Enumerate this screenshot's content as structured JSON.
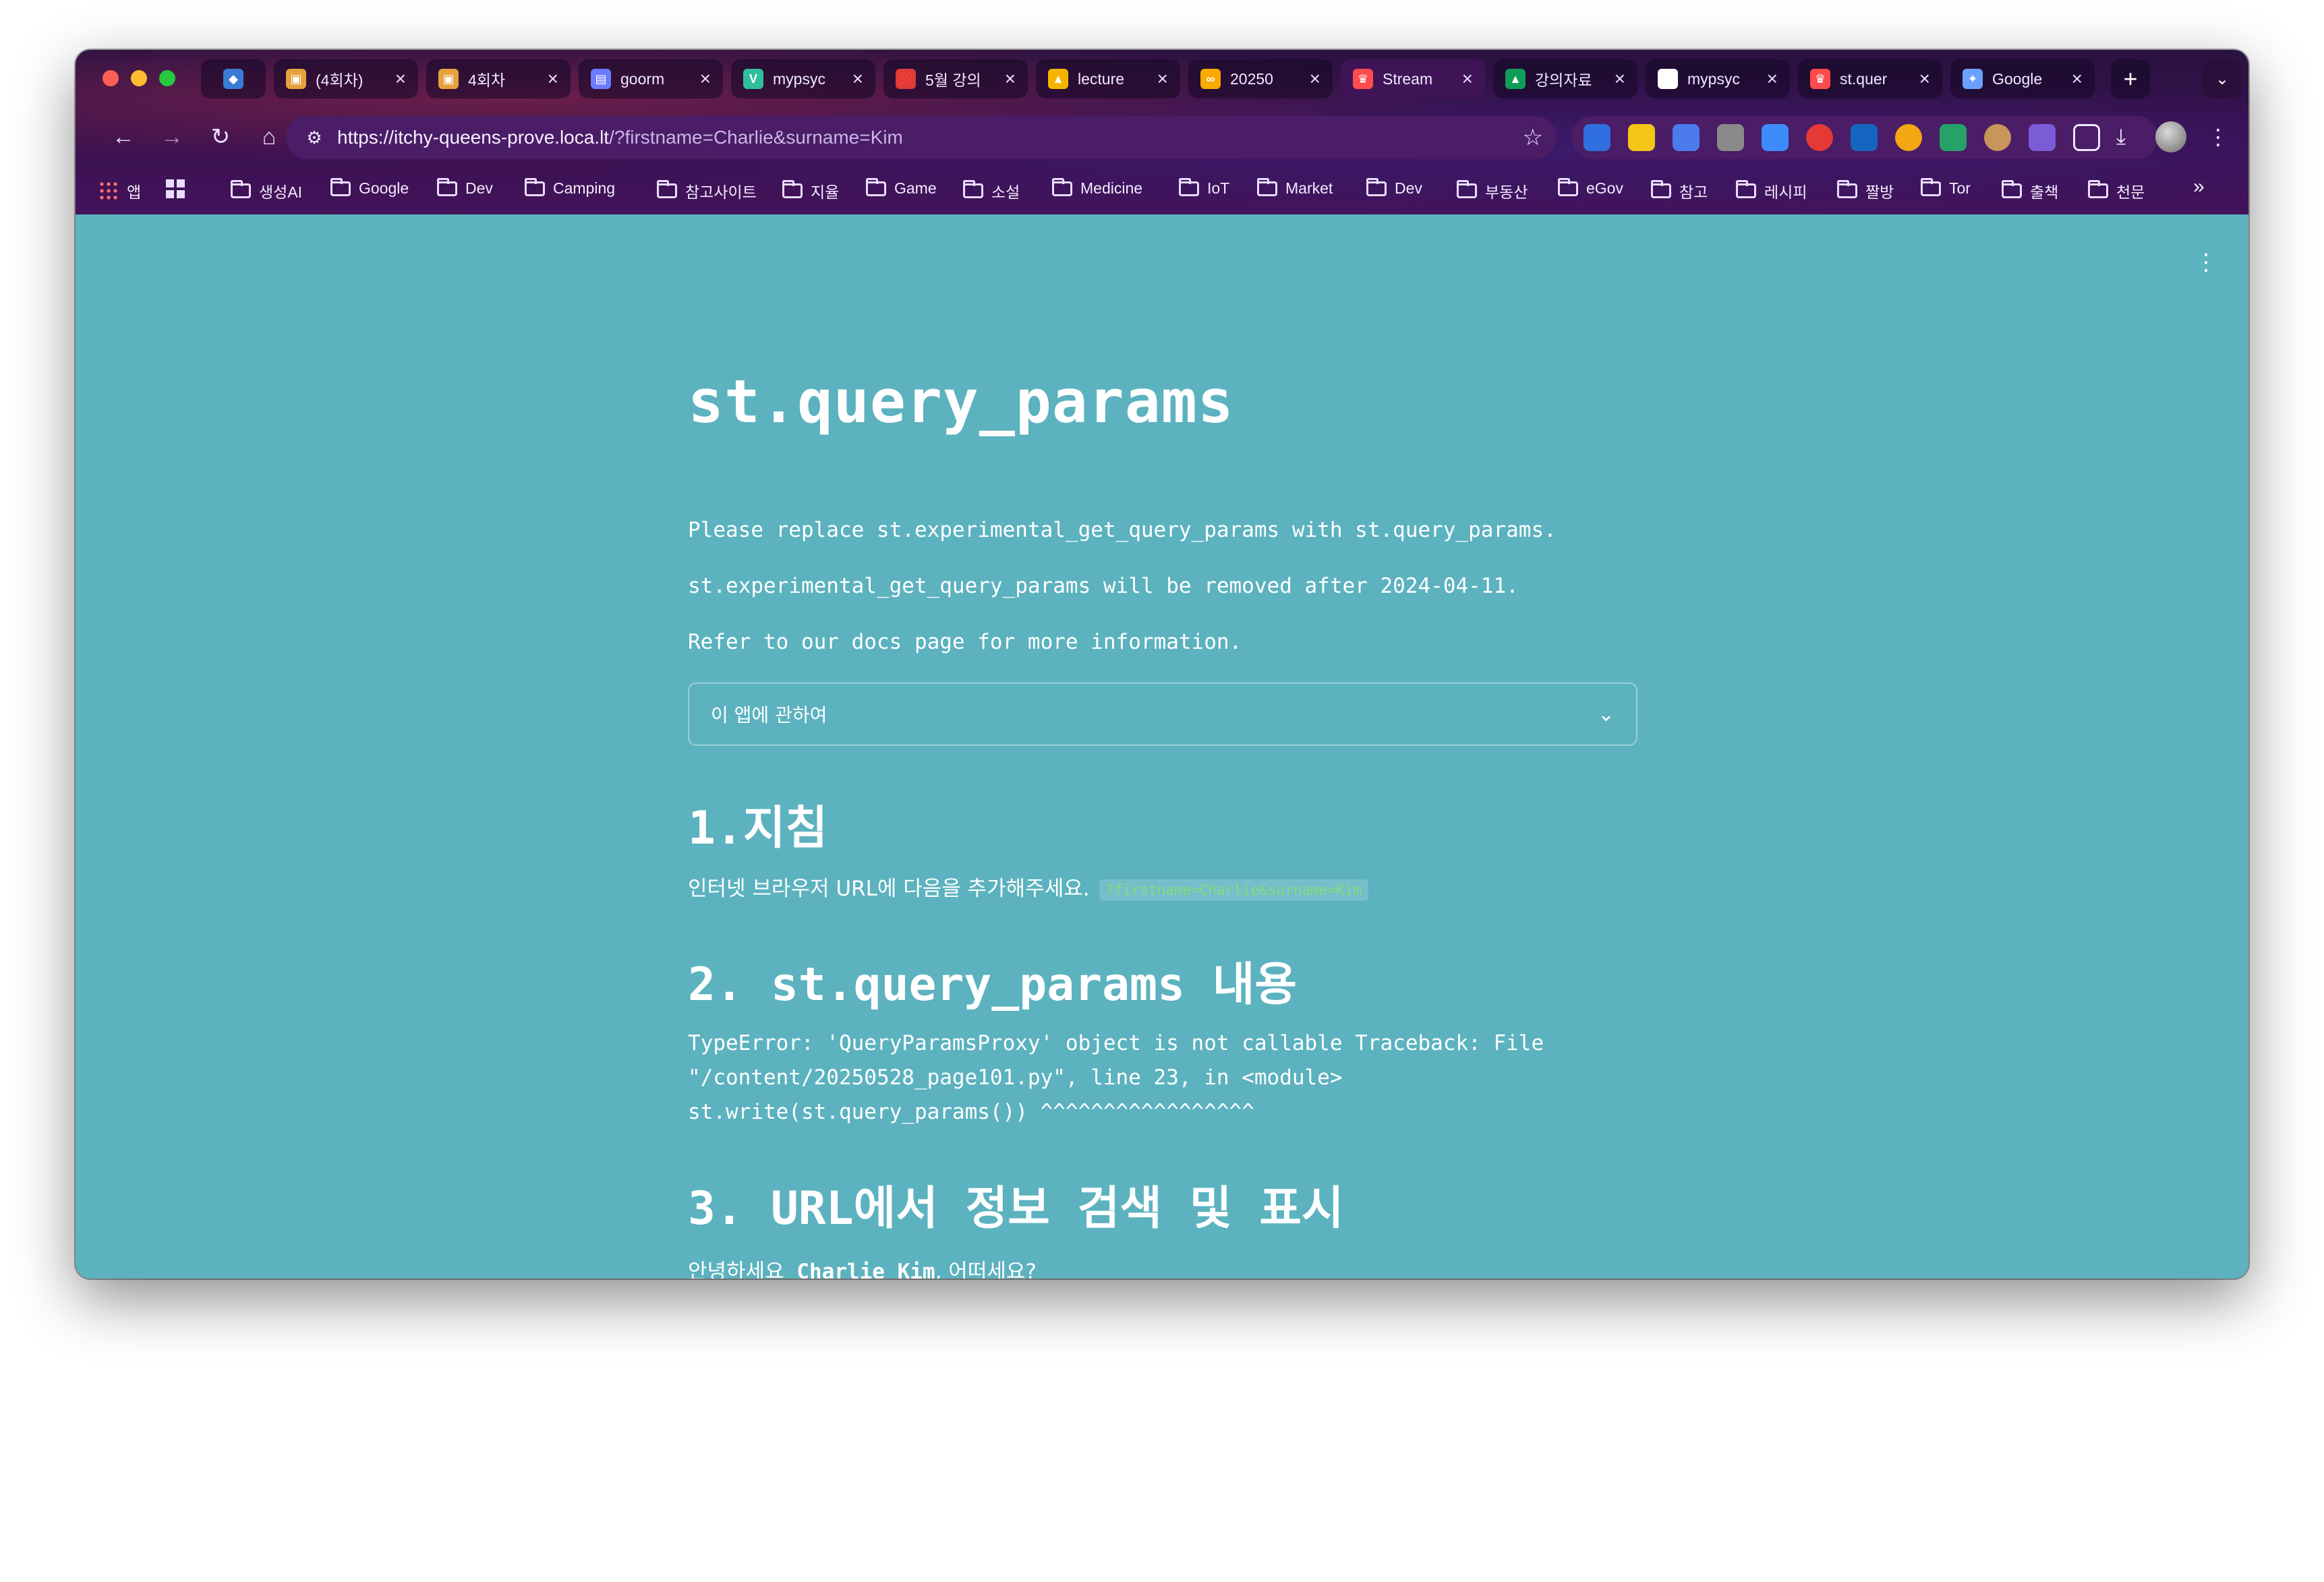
{
  "browser": {
    "tabs": [
      {
        "label": "",
        "favicon": "gem-icon",
        "color": "#3a7bd5",
        "glyph": "◆"
      },
      {
        "label": "(4회차)",
        "favicon": "box-icon",
        "color": "#e6a23c",
        "glyph": "▣"
      },
      {
        "label": "4회차",
        "favicon": "box-icon",
        "color": "#e6a23c",
        "glyph": "▣"
      },
      {
        "label": "goorm",
        "favicon": "goorm-icon",
        "color": "#6b7bff",
        "glyph": "▤"
      },
      {
        "label": "mypsyc",
        "favicon": "v-icon",
        "color": "#2fbf9c",
        "glyph": "V"
      },
      {
        "label": "5월 강의",
        "favicon": "hundred-icon",
        "color": "#e03a3a",
        "glyph": "💯"
      },
      {
        "label": "lecture",
        "favicon": "drive-icon",
        "color": "#f4b400",
        "glyph": "▲"
      },
      {
        "label": "20250",
        "favicon": "colab-icon",
        "color": "#f9ab00",
        "glyph": "∞"
      },
      {
        "label": "Stream",
        "favicon": "streamlit-icon",
        "color": "#ff4b4b",
        "glyph": "♛"
      },
      {
        "label": "강의자료",
        "favicon": "drive-icon",
        "color": "#0f9d58",
        "glyph": "▲"
      },
      {
        "label": "mypsyc",
        "favicon": "github-icon",
        "color": "#ffffff",
        "glyph": "●"
      },
      {
        "label": "st.quer",
        "favicon": "streamlit-icon",
        "color": "#ff4b4b",
        "glyph": "♛"
      },
      {
        "label": "Google",
        "favicon": "gemini-icon",
        "color": "#6aa0ff",
        "glyph": "✦"
      }
    ],
    "url_host": "https://itchy-queens-prove.loca.lt",
    "url_rest": "/?firstname=Charlie&surname=Kim",
    "bookmarks": [
      "앱",
      "",
      "생성AI",
      "Google",
      "Dev",
      "Camping",
      "참고사이트",
      "지율",
      "Game",
      "소설",
      "Medicine",
      "IoT",
      "Market",
      "Dev",
      "부동산",
      "eGov",
      "참고",
      "레시피",
      "짤방",
      "Tor",
      "출책",
      "천문"
    ]
  },
  "page": {
    "title": "st.query_params",
    "notice_line1": "Please replace st.experimental_get_query_params with st.query_params.",
    "notice_line2": "st.experimental_get_query_params will be removed after 2024-04-11.",
    "notice_line3": "Refer to our docs page for more information.",
    "expander_label": "이 앱에 관하여",
    "section1_title": "1.지침",
    "section1_text": "인터넷 브라우저 URL에 다음을 추가해주세요.",
    "section1_code": "?firstname=Charlie&surname=Kim",
    "section2_title": "2. st.query_params 내용",
    "error_line1": "TypeError: 'QueryParamsProxy' object is not callable Traceback: File",
    "error_line2": "\"/content/20250528_page101.py\", line 23, in <module>",
    "error_line3": "st.write(st.query_params()) ^^^^^^^^^^^^^^^^^",
    "section3_title": "3. URL에서 정보 검색 및 표시",
    "greeting_prefix": "안녕하세요",
    "greeting_name": "Charlie Kim",
    "greeting_suffix": ", 어떠세요?"
  },
  "colors": {
    "page_bg": "#5cb2bf",
    "chrome_bg": "#3a1152",
    "code_fg": "#7fe07a"
  }
}
